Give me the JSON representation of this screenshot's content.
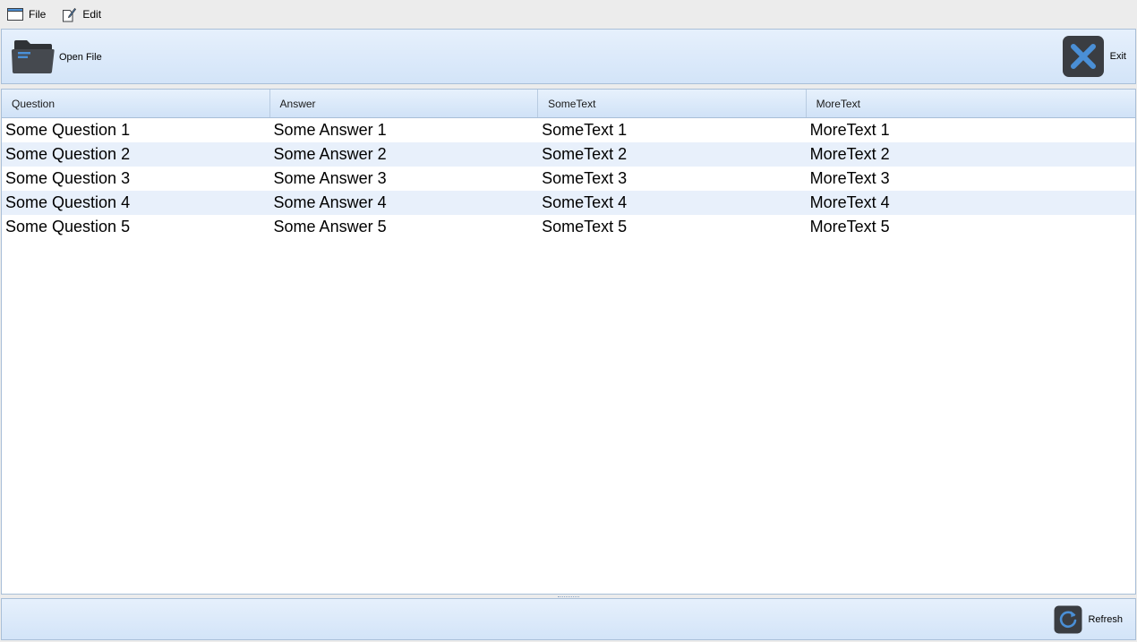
{
  "menubar": {
    "items": [
      {
        "label": "File",
        "icon": "window-icon"
      },
      {
        "label": "Edit",
        "icon": "edit-document-icon"
      }
    ]
  },
  "toolbar": {
    "open_label": "Open File",
    "open_icon": "folder-icon",
    "exit_label": "Exit",
    "exit_icon": "close-x-icon"
  },
  "table": {
    "columns": [
      "Question",
      "Answer",
      "SomeText",
      "MoreText"
    ],
    "rows": [
      [
        "Some Question 1",
        "Some Answer 1",
        "SomeText 1",
        "MoreText 1"
      ],
      [
        "Some Question 2",
        "Some Answer 2",
        "SomeText 2",
        "MoreText 2"
      ],
      [
        "Some Question 3",
        "Some Answer 3",
        "SomeText 3",
        "MoreText 3"
      ],
      [
        "Some Question 4",
        "Some Answer 4",
        "SomeText 4",
        "MoreText 4"
      ],
      [
        "Some Question 5",
        "Some Answer 5",
        "SomeText 5",
        "MoreText 5"
      ]
    ]
  },
  "bottombar": {
    "refresh_label": "Refresh",
    "refresh_icon": "refresh-icon"
  },
  "colors": {
    "toolbar_gradient_top": "#e6f0fc",
    "toolbar_gradient_bottom": "#d3e4f8",
    "alt_row": "#e8f0fb",
    "icon_dark": "#3a3d42",
    "icon_accent": "#4a8fd6"
  }
}
